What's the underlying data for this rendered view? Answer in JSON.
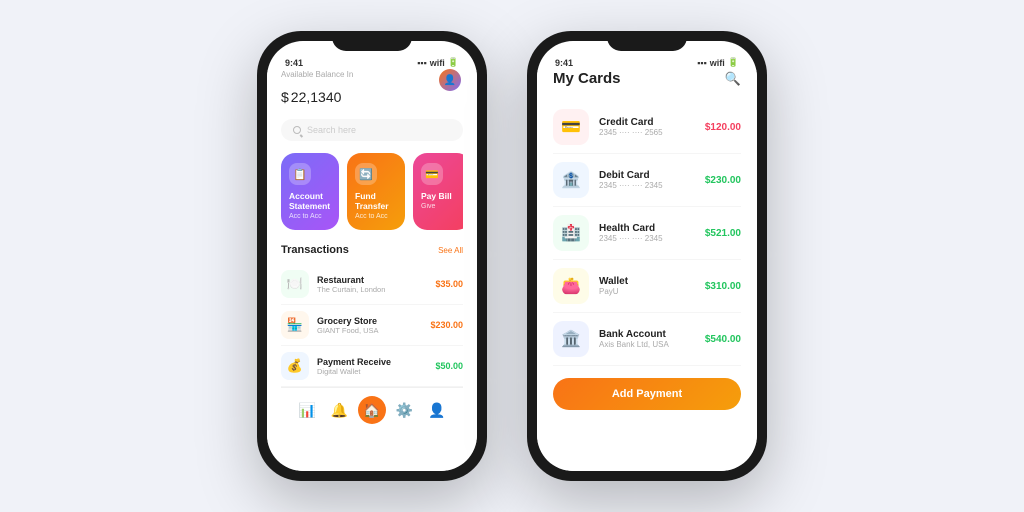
{
  "background": "#f0f2f8",
  "phone_left": {
    "status_time": "9:41",
    "available_label": "Available Balance In",
    "balance_symbol": "$",
    "balance": "22,1340",
    "search_placeholder": "Search here",
    "action_cards": [
      {
        "id": "account-statement",
        "label": "Account Statement",
        "sub": "Acc to Acc",
        "icon": "📋",
        "color": "purple"
      },
      {
        "id": "fund-transfer",
        "label": "Fund Transfer",
        "sub": "Acc to Acc",
        "icon": "🔄",
        "color": "orange"
      },
      {
        "id": "pay-bill",
        "label": "Pay Bill",
        "sub": "Give",
        "icon": "💳",
        "color": "pink"
      }
    ],
    "transactions_title": "Transactions",
    "see_all": "See All",
    "transactions": [
      {
        "name": "Restaurant",
        "sub": "The Curtain, London",
        "amount": "$35.00",
        "type": "debit",
        "icon": "🍽️",
        "bg": "#f0fdf4"
      },
      {
        "name": "Grocery Store",
        "sub": "GIANT Food, USA",
        "amount": "$230.00",
        "type": "debit",
        "icon": "🏪",
        "bg": "#fff7ed"
      },
      {
        "name": "Payment Receive",
        "sub": "Digital Wallet",
        "amount": "$50.00",
        "type": "credit",
        "icon": "💰",
        "bg": "#eff6ff"
      }
    ],
    "nav_items": [
      "📊",
      "🔔",
      "🏠",
      "⚙️",
      "👤"
    ]
  },
  "phone_right": {
    "status_time": "9:41",
    "title": "My Cards",
    "cards": [
      {
        "name": "Credit Card",
        "number": "2345  ····  ····  2565",
        "amount": "$120.00",
        "amount_type": "red",
        "icon": "💳",
        "bg": "red-bg"
      },
      {
        "name": "Debit Card",
        "number": "2345  ····  ····  2345",
        "amount": "$230.00",
        "amount_type": "green",
        "icon": "🏦",
        "bg": "blue-bg"
      },
      {
        "name": "Health Card",
        "number": "2345  ····  ····  2345",
        "amount": "$521.00",
        "amount_type": "green",
        "icon": "🏥",
        "bg": "teal-bg"
      },
      {
        "name": "Wallet",
        "number": "PayU",
        "amount": "$310.00",
        "amount_type": "green",
        "icon": "👛",
        "bg": "yellow-bg"
      },
      {
        "name": "Bank Account",
        "number": "Axis Bank Ltd, USA",
        "amount": "$540.00",
        "amount_type": "green",
        "icon": "🏛️",
        "bg": "indigo-bg"
      }
    ],
    "add_payment_label": "Add Payment"
  }
}
